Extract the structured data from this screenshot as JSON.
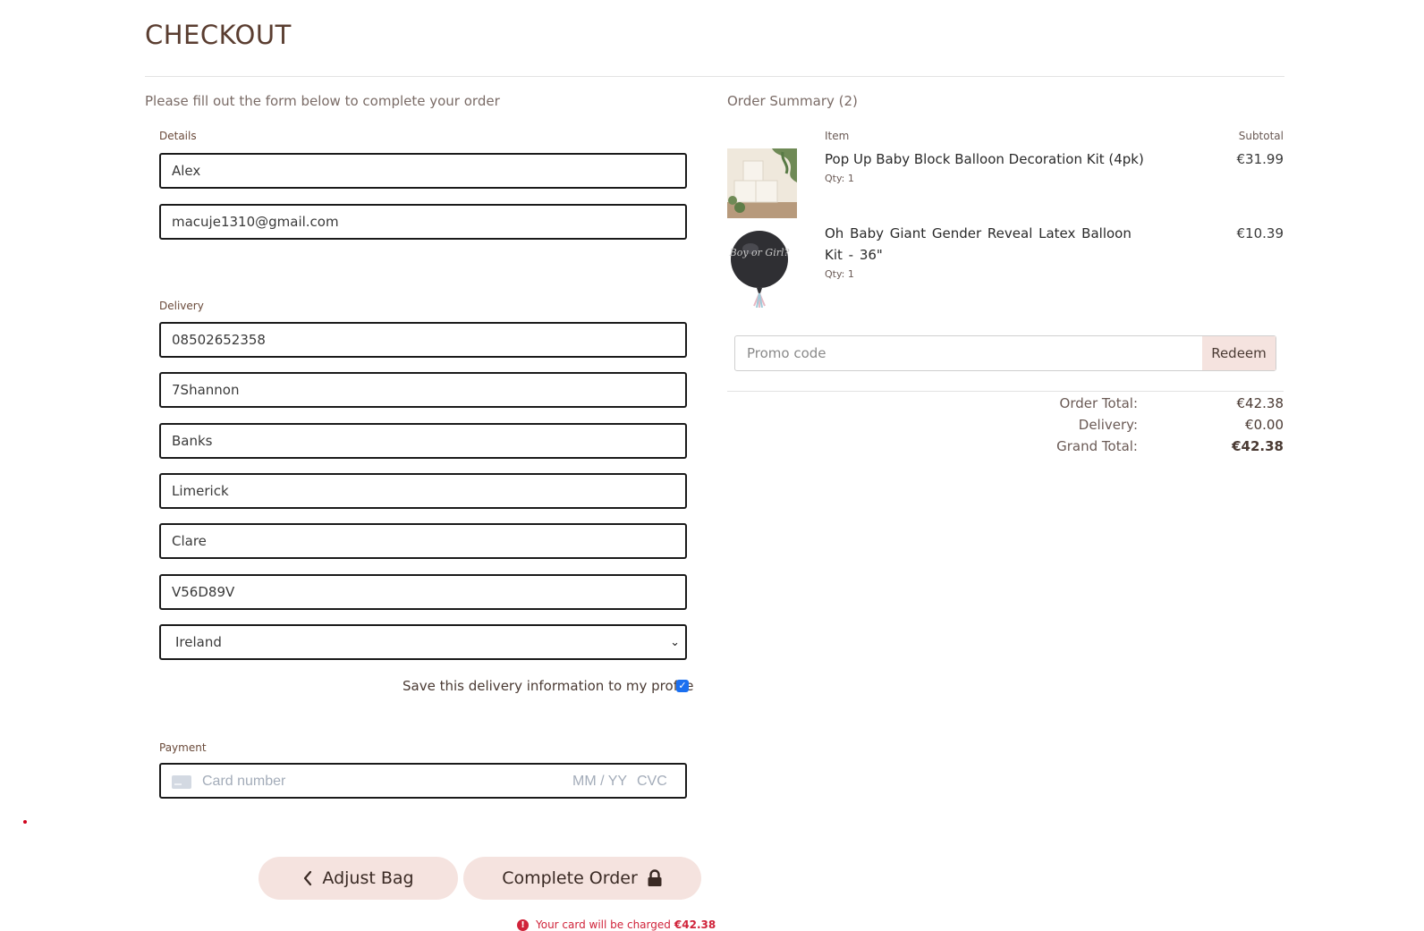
{
  "page": {
    "title": "CHECKOUT",
    "intro": "Please fill out the form below to complete your order"
  },
  "form": {
    "details_label": "Details",
    "full_name": "Alex",
    "email": "macuje1310@gmail.com",
    "delivery_label": "Delivery",
    "phone": "08502652358",
    "street1": "7Shannon",
    "street2": "Banks",
    "town": "Limerick",
    "county": "Clare",
    "postcode": "V56D89V",
    "country": "Ireland",
    "save_info_label": "Save this delivery information to my profile",
    "save_info_checked": true,
    "payment_label": "Payment",
    "card_number_placeholder": "Card number",
    "card_expiry_placeholder": "MM / YY",
    "card_cvc_placeholder": "CVC"
  },
  "actions": {
    "adjust_bag": "Adjust Bag",
    "complete_order": "Complete Order",
    "charge_note": "Your card will be charged",
    "charge_amount": "€42.38"
  },
  "summary": {
    "title": "Order Summary (2)",
    "item_header": "Item",
    "subtotal_header": "Subtotal",
    "items": [
      {
        "name": "Pop Up Baby Block Balloon Decoration Kit (4pk)",
        "qty": "Qty: 1",
        "price": "€31.99"
      },
      {
        "name": "Oh Baby Giant Gender Reveal Latex Balloon Kit - 36\"",
        "qty": "Qty: 1",
        "price": "€10.39",
        "image_text": "Boy or Girl?"
      }
    ],
    "promo_placeholder": "Promo code",
    "redeem_label": "Redeem",
    "order_total_label": "Order Total:",
    "order_total": "€42.38",
    "delivery_label": "Delivery:",
    "delivery": "€0.00",
    "grand_total_label": "Grand Total:",
    "grand_total": "€42.38"
  },
  "colors": {
    "button_bg": "#f5e3df",
    "title": "#5a3d30",
    "error": "#d0233a",
    "checkbox": "#1a6ff0"
  }
}
